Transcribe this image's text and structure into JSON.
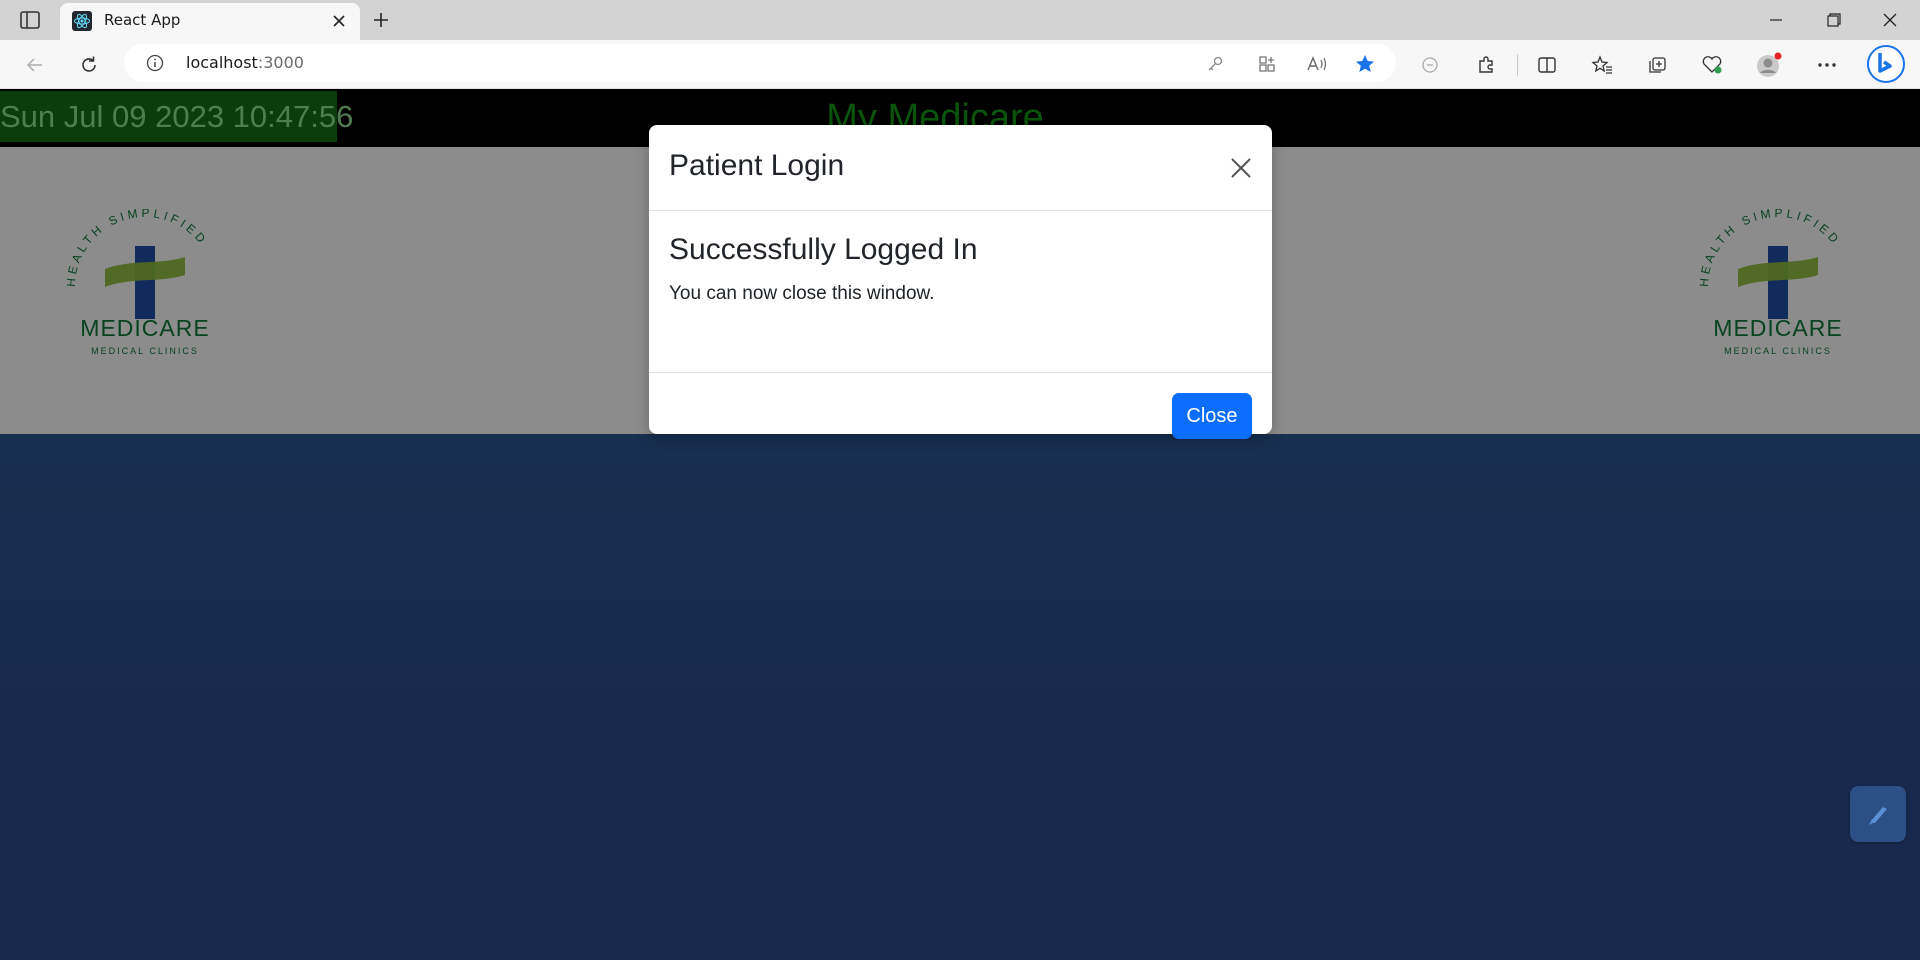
{
  "browser": {
    "tab_title": "React App",
    "url_host": "localhost",
    "url_port": ":3000"
  },
  "page": {
    "clock": "Sun Jul 09 2023 10:47:56",
    "brand_title": "My Medicare",
    "logo": {
      "arc_text": "HEALTH SIMPLIFIED",
      "word": "MEDICARE",
      "sub": "MEDICAL CLINICS"
    }
  },
  "modal": {
    "title": "Patient Login",
    "heading": "Successfully Logged In",
    "text": "You can now close this window.",
    "close_button": "Close"
  },
  "colors": {
    "clock_bg": "#147014",
    "brand": "#149a14",
    "primary_button": "#0d6efd",
    "logo_green": "#0f7a3a",
    "logo_blue": "#1f4fa8",
    "logo_lime": "#8fbf3a"
  },
  "icons": {
    "tab_actions": "tab-actions-icon",
    "favicon": "react-icon",
    "back": "back-arrow-icon",
    "refresh": "refresh-icon",
    "info": "info-icon",
    "favorite": "star-icon",
    "extensions": "puzzle-icon",
    "more": "more-icon"
  }
}
